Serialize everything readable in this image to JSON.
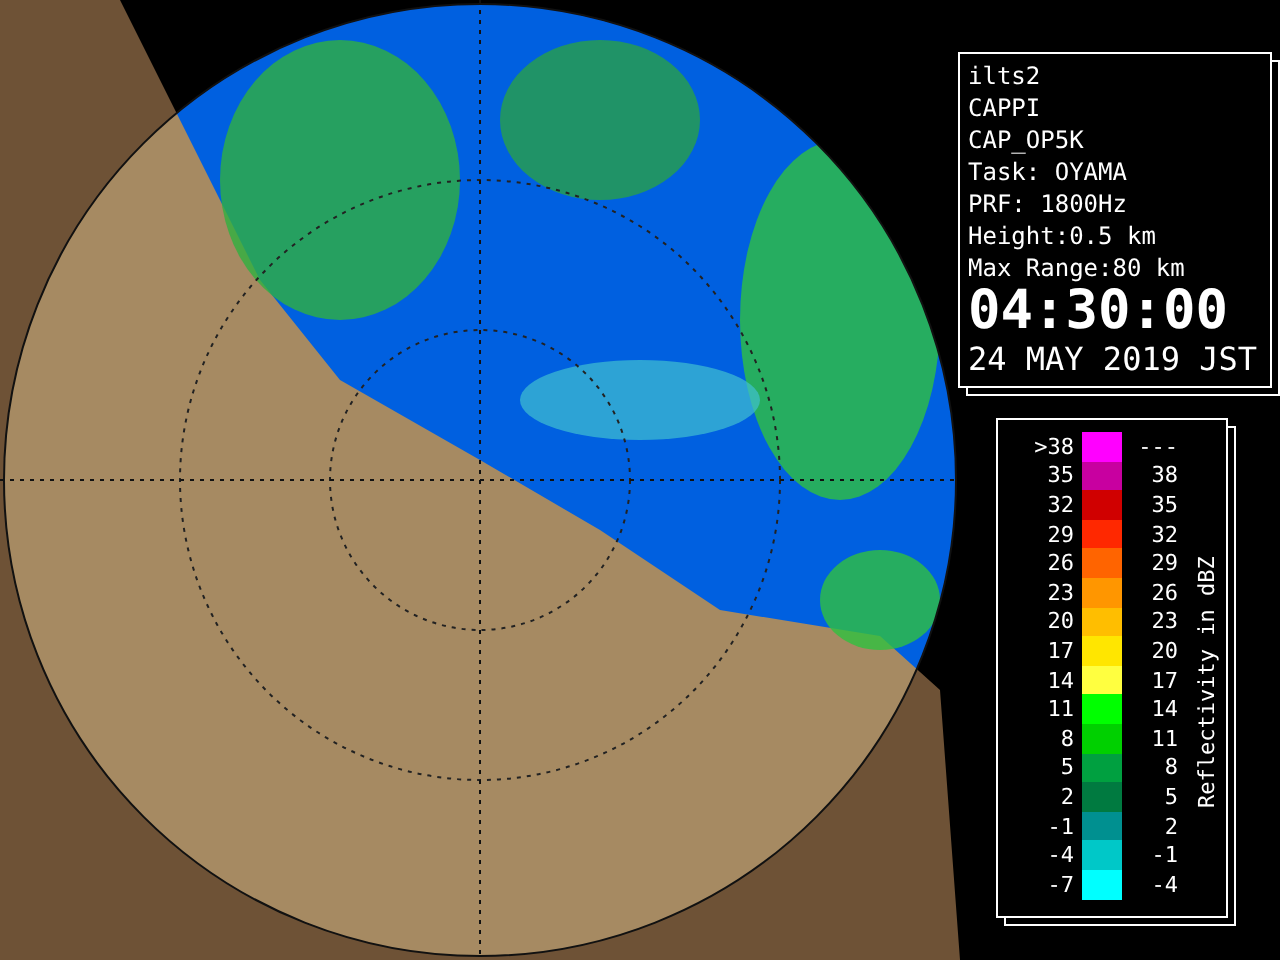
{
  "info_panel": {
    "lines": [
      "ilts2",
      "CAPPI",
      "CAP_OP5K",
      "Task: OYAMA",
      "PRF: 1800Hz",
      "Height:0.5 km",
      "Max Range:80 km"
    ],
    "time": "04:30:00",
    "date": "24 MAY 2019 JST"
  },
  "legend": {
    "title": "Reflectivity in dBZ",
    "rows": [
      {
        "low": ">38",
        "high": "---",
        "color": "#ff00ff"
      },
      {
        "low": "35",
        "high": "38",
        "color": "#c800a0"
      },
      {
        "low": "32",
        "high": "35",
        "color": "#d00000"
      },
      {
        "low": "29",
        "high": "32",
        "color": "#ff2800"
      },
      {
        "low": "26",
        "high": "29",
        "color": "#ff6400"
      },
      {
        "low": "23",
        "high": "26",
        "color": "#ff9600"
      },
      {
        "low": "20",
        "high": "23",
        "color": "#ffbe00"
      },
      {
        "low": "17",
        "high": "20",
        "color": "#ffe600"
      },
      {
        "low": "14",
        "high": "17",
        "color": "#ffff40"
      },
      {
        "low": "11",
        "high": "14",
        "color": "#00ff00"
      },
      {
        "low": "8",
        "high": "11",
        "color": "#00d000"
      },
      {
        "low": "5",
        "high": "8",
        "color": "#00a040"
      },
      {
        "low": "2",
        "high": "5",
        "color": "#007a40"
      },
      {
        "low": "-1",
        "high": "2",
        "color": "#009090"
      },
      {
        "low": "-4",
        "high": "-1",
        "color": "#00c8c8"
      },
      {
        "low": "-7",
        "high": "-4",
        "color": "#00ffff"
      }
    ]
  }
}
